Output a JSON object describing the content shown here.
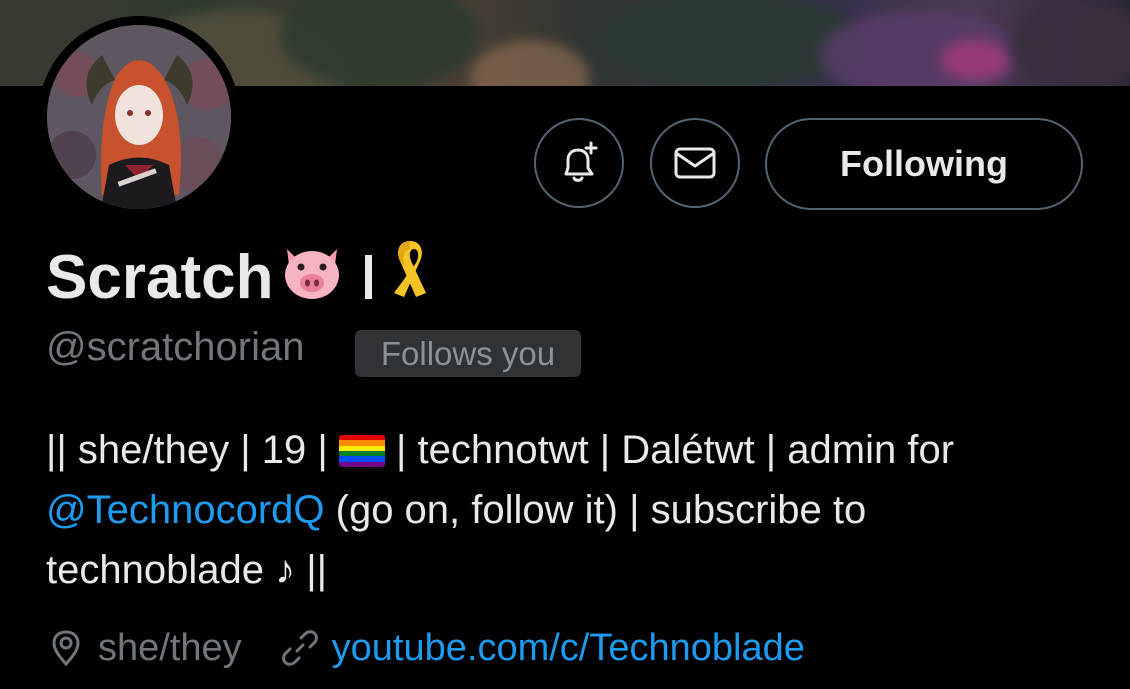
{
  "profile": {
    "display_name": "Scratch",
    "handle": "@scratchorian",
    "follows_you_badge": "Follows you",
    "bio": {
      "line1_before_flag": "|| she/they | 19 |",
      "line1_after_flag": "| technotwt | Dalétwt | admin for",
      "mention": "@TechnocordQ",
      "line2_rest": " (go on, follow it) | subscribe to",
      "line3": "technoblade ♪ ||"
    },
    "location": "she/they",
    "website": "youtube.com/c/Technoblade"
  },
  "actions": {
    "notify_icon": "bell-plus-icon",
    "message_icon": "envelope-icon",
    "following_label": "Following"
  },
  "icons": {
    "pig_emoji": "pig-face-icon",
    "ribbon_emoji": "yellow-ribbon-icon",
    "flag_emoji": "rainbow-flag-icon",
    "location": "location-pin-icon",
    "link": "link-icon"
  },
  "colors": {
    "background": "#000000",
    "text_primary": "#e7e9ea",
    "text_secondary": "#71767b",
    "link": "#1d9bf0",
    "border": "#536471",
    "badge_bg": "#2f3336"
  }
}
